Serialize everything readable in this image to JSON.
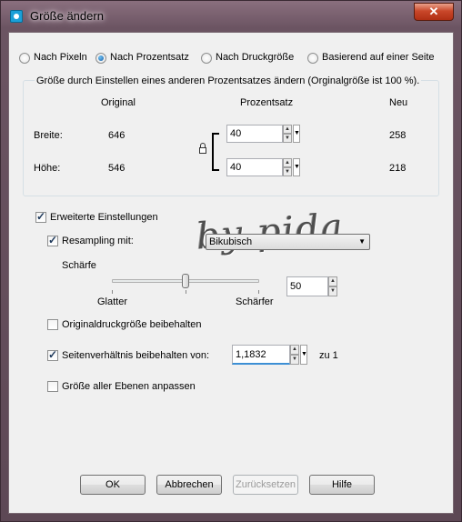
{
  "window": {
    "title": "Größe ändern",
    "close_glyph": "✕"
  },
  "mode": {
    "options": [
      {
        "label": "Nach Pixeln",
        "selected": false
      },
      {
        "label": "Nach Prozentsatz",
        "selected": true
      },
      {
        "label": "Nach Druckgröße",
        "selected": false
      },
      {
        "label": "Basierend auf einer Seite",
        "selected": false
      }
    ]
  },
  "group": {
    "caption": "Größe durch Einstellen eines anderen Prozentsatzes ändern (Orginalgröße ist 100 %).",
    "col_original": "Original",
    "col_percent": "Prozentsatz",
    "col_new": "Neu",
    "width_label": "Breite:",
    "width_original": "646",
    "width_percent": "40",
    "width_new": "258",
    "height_label": "Höhe:",
    "height_original": "546",
    "height_percent": "40",
    "height_new": "218"
  },
  "advanced": {
    "label": "Erweiterte Einstellungen",
    "checked": true,
    "resampling_label": "Resampling mit:",
    "resampling_checked": true,
    "resampling_value": "Bikubisch",
    "sharpness_label": "Schärfe",
    "smoother_label": "Glatter",
    "sharper_label": "Schärfer",
    "sharpness_value": "50",
    "keep_print_label": "Originaldruckgröße beibehalten",
    "keep_print_checked": false,
    "aspect_label": "Seitenverhältnis beibehalten von:",
    "aspect_checked": true,
    "aspect_value": "1,1832",
    "aspect_suffix": "zu 1",
    "all_layers_label": "Größe aller Ebenen anpassen",
    "all_layers_checked": false
  },
  "watermark": "by pida",
  "buttons": {
    "ok": "OK",
    "cancel": "Abbrechen",
    "reset": "Zurücksetzen",
    "help": "Hilfe"
  },
  "icons": {
    "window_icon": "camera-icon",
    "lock": "lock-icon"
  }
}
